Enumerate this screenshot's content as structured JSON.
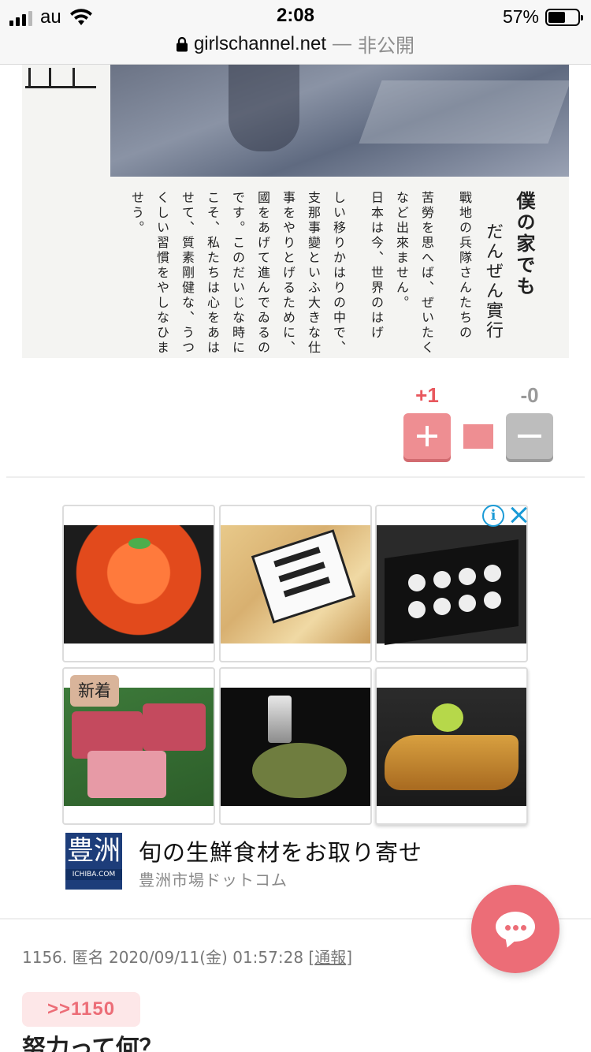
{
  "status_bar": {
    "carrier": "au",
    "time": "2:08",
    "battery_percent": "57%",
    "battery_level": 0.57
  },
  "url_bar": {
    "domain": "girlschannel.net",
    "separator": "—",
    "privacy": "非公開"
  },
  "article_scan": {
    "headline": "僕の家でも",
    "subhead": "だんぜん實行",
    "body_columns": [
      "戰地の兵隊さんたちの",
      "苦勞を思へば、ぜいたく",
      "など出來ません。",
      "日本は今、世界のはげ",
      "しい移りかはりの中で、",
      "支那事變といふ大きな仕",
      "事をやりとげるために、",
      "國をあげて進んでゐるの",
      "です。このだいじな時に",
      "こそ、私たちは心をあは",
      "せて、質素剛健な、うつ",
      "くしい習慣をやしなひま",
      "せう。"
    ]
  },
  "vote": {
    "plus_count": "+1",
    "minus_count": "-0",
    "plus_ratio": 1.0
  },
  "ad": {
    "tiles": [
      {
        "icon": "ikura-bowl-image"
      },
      {
        "icon": "noodle-package-image"
      },
      {
        "icon": "chocolate-box-image"
      },
      {
        "icon": "tuna-image",
        "badge": "新着"
      },
      {
        "icon": "appetizer-image"
      },
      {
        "icon": "grilled-fish-image"
      }
    ],
    "advertiser_logo_text": "豊洲",
    "advertiser_logo_small": "ICHIBA.COM",
    "title": "旬の生鮮食材をお取り寄せ",
    "source": "豊洲市場ドットコム",
    "info_icon": "i"
  },
  "comment": {
    "number": "1156.",
    "author": "匿名",
    "datetime": "2020/09/11(金) 01:57:28",
    "report_label": "通報",
    "reply_to": ">>1150",
    "body": "努力って何？"
  },
  "colors": {
    "accent": "#ec6d77",
    "plus_button": "#ee8e92",
    "minus_button": "#bdbdbd",
    "ad_info": "#1a9ad6"
  }
}
